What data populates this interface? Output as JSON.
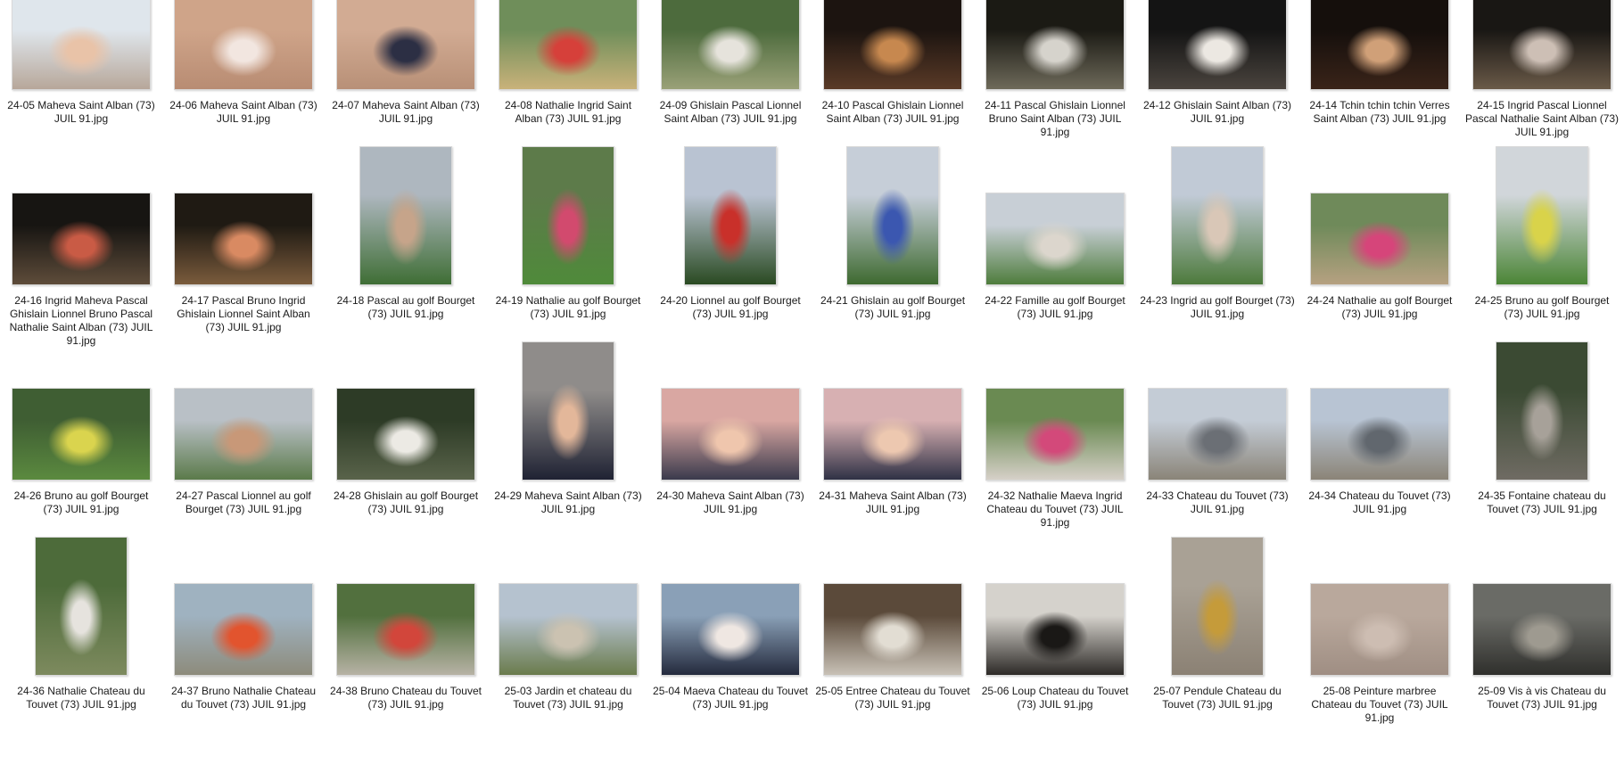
{
  "items": [
    {
      "name": "24-05 Maheva Saint Alban (73) JUIL 91.jpg",
      "orient": "l",
      "top": "#dfe6ec",
      "bottom": "#b7a79a",
      "accent": "#e9c3a8"
    },
    {
      "name": "24-06 Maheva Saint Alban (73) JUIL 91.jpg",
      "orient": "l",
      "top": "#cfa489",
      "bottom": "#b88c73",
      "accent": "#f2e6e0"
    },
    {
      "name": "24-07 Maheva Saint Alban (73) JUIL 91.jpg",
      "orient": "l",
      "top": "#d2ab93",
      "bottom": "#b89077",
      "accent": "#2c2f44"
    },
    {
      "name": "24-08 Nathalie Ingrid Saint Alban (73) JUIL 91.jpg",
      "orient": "l",
      "top": "#6f8e5a",
      "bottom": "#c9b27a",
      "accent": "#d6403a"
    },
    {
      "name": "24-09 Ghislain Pascal Lionnel Saint Alban (73) JUIL 91.jpg",
      "orient": "l",
      "top": "#4d6b3d",
      "bottom": "#9aa178",
      "accent": "#e6e3dc"
    },
    {
      "name": "24-10 Pascal Ghislain Lionnel Saint Alban (73) JUIL 91.jpg",
      "orient": "l",
      "top": "#1c1410",
      "bottom": "#5a3a27",
      "accent": "#c7884f"
    },
    {
      "name": "24-11 Pascal Ghislain Lionnel Bruno Saint Alban (73) JUIL 91.jpg",
      "orient": "l",
      "top": "#1b1a14",
      "bottom": "#6e6a5a",
      "accent": "#d6d3cc"
    },
    {
      "name": "24-12 Ghislain Saint Alban (73) JUIL 91.jpg",
      "orient": "l",
      "top": "#141414",
      "bottom": "#4a443e",
      "accent": "#ece8e2"
    },
    {
      "name": "24-14 Tchin tchin tchin Verres Saint Alban (73) JUIL 91.jpg",
      "orient": "l",
      "top": "#150f0c",
      "bottom": "#3a2419",
      "accent": "#d0a078"
    },
    {
      "name": "24-15 Ingrid Pascal  Lionnel Pascal Nathalie Saint Alban (73) JUIL 91.jpg",
      "orient": "l",
      "top": "#191714",
      "bottom": "#6a5a48",
      "accent": "#cdbfb5"
    },
    {
      "name": "24-16 Ingrid Maheva Pascal Ghislain Lionnel Bruno Pascal Nathalie Saint Alban (73) JUIL 91.jpg",
      "orient": "l",
      "top": "#171512",
      "bottom": "#5e4c3a",
      "accent": "#c95b45"
    },
    {
      "name": "24-17 Pascal Bruno Ingrid Ghislain Lionnel Saint Alban (73) JUIL 91.jpg",
      "orient": "l",
      "top": "#1f1a13",
      "bottom": "#7a5b3c",
      "accent": "#d98a62"
    },
    {
      "name": "24-18 Pascal au golf Bourget (73) JUIL 91.jpg",
      "orient": "p",
      "top": "#aeb7bf",
      "bottom": "#3f6e35",
      "accent": "#c6a48a"
    },
    {
      "name": "24-19 Nathalie  au golf Bourget (73) JUIL 91.jpg",
      "orient": "p",
      "top": "#5d7b4a",
      "bottom": "#4f8a3a",
      "accent": "#d24a6e"
    },
    {
      "name": "24-20 Lionnel au golf Bourget (73) JUIL 91.jpg",
      "orient": "p",
      "top": "#b9c3d2",
      "bottom": "#2a4a22",
      "accent": "#c9302a"
    },
    {
      "name": "24-21 Ghislain au golf Bourget (73) JUIL 91.jpg",
      "orient": "p",
      "top": "#c6ced8",
      "bottom": "#3e6a30",
      "accent": "#3b57b0"
    },
    {
      "name": "24-22 Famille au golf Bourget (73) JUIL 91.jpg",
      "orient": "l",
      "top": "#c8cfd6",
      "bottom": "#4e7c3c",
      "accent": "#dcd6cd"
    },
    {
      "name": "24-23 Ingrid au golf Bourget (73) JUIL 91.jpg",
      "orient": "p",
      "top": "#c1cad6",
      "bottom": "#4d7a3c",
      "accent": "#d9c7b7"
    },
    {
      "name": "24-24 Nathalie  au golf Bourget (73) JUIL 91.jpg",
      "orient": "l",
      "top": "#6f8a5a",
      "bottom": "#b6a181",
      "accent": "#d6457a"
    },
    {
      "name": "24-25 Bruno au golf Bourget (73) JUIL 91.jpg",
      "orient": "p",
      "top": "#d1d6da",
      "bottom": "#4b8536",
      "accent": "#d9d34a"
    },
    {
      "name": "24-26 Bruno au golf Bourget (73) JUIL 91.jpg",
      "orient": "l",
      "top": "#3f5e33",
      "bottom": "#5b8a3f",
      "accent": "#dad44e"
    },
    {
      "name": "24-27 Pascal Lionnel au golf Bourget (73) JUIL 91.jpg",
      "orient": "l",
      "top": "#b9c0c6",
      "bottom": "#5b7a4a",
      "accent": "#c89878"
    },
    {
      "name": "24-28 Ghislain au golf Bourget (73) JUIL 91.jpg",
      "orient": "l",
      "top": "#2d3b26",
      "bottom": "#59634a",
      "accent": "#eceae4"
    },
    {
      "name": "24-29 Maheva Saint Alban (73) JUIL 91.jpg",
      "orient": "p",
      "top": "#8f8c8a",
      "bottom": "#1f2233",
      "accent": "#e3b79a"
    },
    {
      "name": "24-30 Maheva Saint Alban (73) JUIL 91.jpg",
      "orient": "l",
      "top": "#d9a7a2",
      "bottom": "#3a3a4c",
      "accent": "#efc6ad"
    },
    {
      "name": "24-31 Maheva Saint Alban (73) JUIL 91.jpg",
      "orient": "l",
      "top": "#d7b0b2",
      "bottom": "#2f3145",
      "accent": "#edc8b0"
    },
    {
      "name": "24-32 Nathalie Maeva Ingrid Chateau du Touvet (73) JUIL 91.jpg",
      "orient": "l",
      "top": "#6a8a52",
      "bottom": "#d6d0c8",
      "accent": "#d3497a"
    },
    {
      "name": "24-33 Chateau du Touvet (73) JUIL 91.jpg",
      "orient": "l",
      "top": "#c4ccd6",
      "bottom": "#8a8478",
      "accent": "#6b6f75"
    },
    {
      "name": "24-34 Chateau du Touvet (73) JUIL 91.jpg",
      "orient": "l",
      "top": "#b8c4d3",
      "bottom": "#8b8477",
      "accent": "#61676e"
    },
    {
      "name": "24-35 Fontaine chateau du Touvet (73) JUIL 91.jpg",
      "orient": "p",
      "top": "#3b4a33",
      "bottom": "#6f6b63",
      "accent": "#a7a199"
    },
    {
      "name": "24-36 Nathalie Chateau du Touvet (73) JUIL 91.jpg",
      "orient": "p",
      "top": "#4d6b3a",
      "bottom": "#7d8a5e",
      "accent": "#e6e3de"
    },
    {
      "name": "24-37 Bruno Nathalie Chateau du Touvet (73) JUIL 91.jpg",
      "orient": "l",
      "top": "#9fb2c0",
      "bottom": "#8d8b7b",
      "accent": "#e2542e"
    },
    {
      "name": "24-38 Bruno  Chateau du Touvet (73) JUIL 91.jpg",
      "orient": "l",
      "top": "#52703e",
      "bottom": "#b7b2a5",
      "accent": "#d2463b"
    },
    {
      "name": "25-03 Jardin et chateau du Touvet (73) JUIL 91.jpg",
      "orient": "l",
      "top": "#b5c2cf",
      "bottom": "#6a7b4c",
      "accent": "#cbc2b1"
    },
    {
      "name": "25-04 Maeva Chateau du Touvet (73) JUIL 91.jpg",
      "orient": "l",
      "top": "#8aa0b7",
      "bottom": "#242a3d",
      "accent": "#efe7e2"
    },
    {
      "name": "25-05 Entree Chateau du Touvet (73) JUIL 91.jpg",
      "orient": "l",
      "top": "#5b4a3a",
      "bottom": "#c8c1b6",
      "accent": "#e2ddd3"
    },
    {
      "name": "25-06 Loup Chateau du Touvet (73) JUIL 91.jpg",
      "orient": "l",
      "top": "#d5d2cc",
      "bottom": "#2d2a27",
      "accent": "#1a1816"
    },
    {
      "name": "25-07 Pendule Chateau du Touvet (73) JUIL 91.jpg",
      "orient": "p",
      "top": "#a9a195",
      "bottom": "#8b8174",
      "accent": "#c59b3a"
    },
    {
      "name": "25-08 Peinture marbree Chateau du Touvet (73) JUIL 91.jpg",
      "orient": "l",
      "top": "#b9a89c",
      "bottom": "#9f8e83",
      "accent": "#cdbdb2"
    },
    {
      "name": "25-09 Vis à vis Chateau du Touvet (73) JUIL 91.jpg",
      "orient": "l",
      "top": "#6a6b66",
      "bottom": "#2f2f2c",
      "accent": "#9e9a90"
    }
  ]
}
